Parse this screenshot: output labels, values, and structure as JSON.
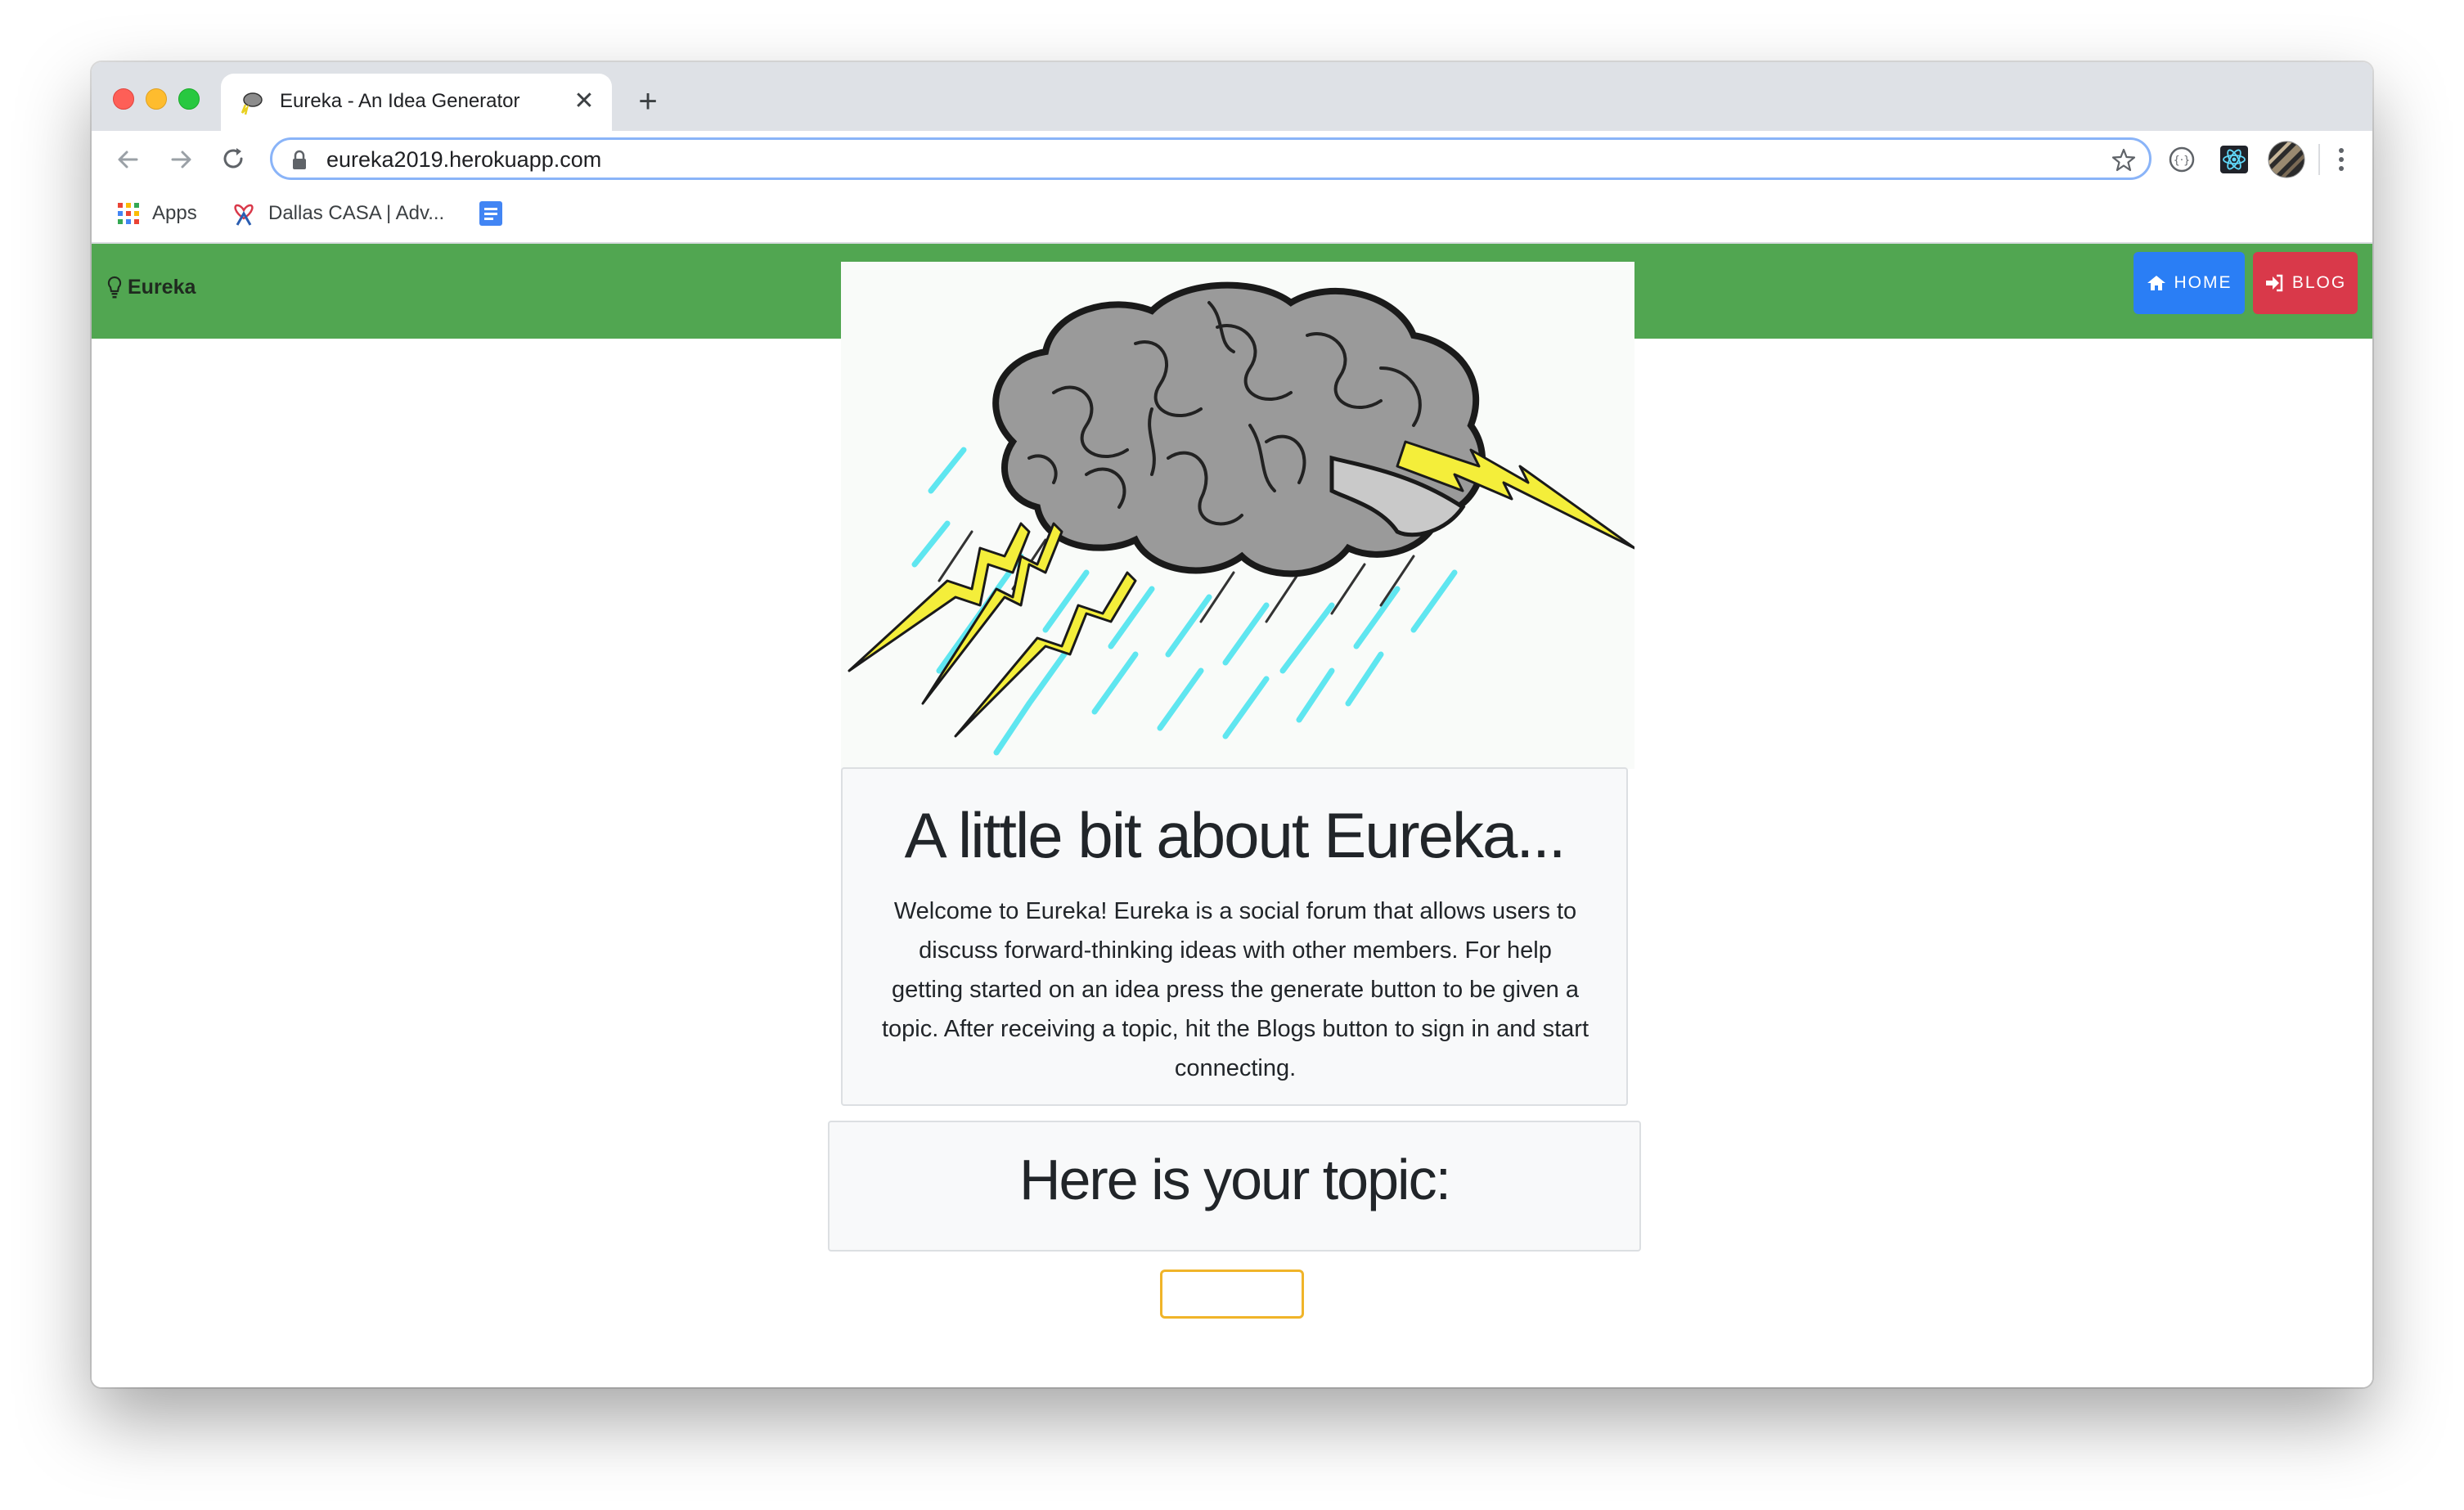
{
  "browser": {
    "tab_title": "Eureka - An Idea Generator",
    "tab_close": "✕",
    "new_tab": "+",
    "url": "eureka2019.herokuapp.com",
    "bookmarks": [
      {
        "label": "Apps",
        "icon": "apps-grid-icon"
      },
      {
        "label": "Dallas CASA | Adv...",
        "icon": "casa-icon"
      },
      {
        "label": "",
        "icon": "google-docs-icon"
      }
    ]
  },
  "navbar": {
    "brand": "Eureka",
    "home_label": "HOME",
    "blog_label": "BLOG",
    "background": "#51a651",
    "home_color": "#2a7ef5",
    "blog_color": "#d9394a"
  },
  "about": {
    "title": "A little bit about Eureka...",
    "text": "Welcome to Eureka! Eureka is a social forum that allows users to discuss forward-thinking ideas with other members. For help getting started on an idea press the generate button to be given a topic. After receiving a topic, hit the Blogs button to sign in and start connecting."
  },
  "topic": {
    "title": "Here is your topic:"
  }
}
